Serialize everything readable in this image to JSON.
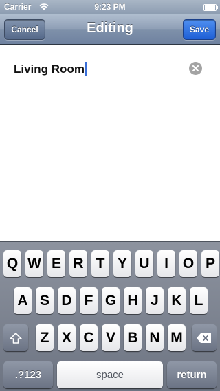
{
  "status_bar": {
    "carrier": "Carrier",
    "time": "9:23 PM",
    "wifi_icon": "wifi-icon",
    "battery_icon": "battery-icon"
  },
  "nav_bar": {
    "title": "Editing",
    "cancel_label": "Cancel",
    "save_label": "Save",
    "save_color": "#2a6ae0"
  },
  "field": {
    "value": "Living Room",
    "clear_icon": "clear-icon"
  },
  "keyboard": {
    "row1": [
      "Q",
      "W",
      "E",
      "R",
      "T",
      "Y",
      "U",
      "I",
      "O",
      "P"
    ],
    "row2": [
      "A",
      "S",
      "D",
      "F",
      "G",
      "H",
      "J",
      "K",
      "L"
    ],
    "row3": [
      "Z",
      "X",
      "C",
      "V",
      "B",
      "N",
      "M"
    ],
    "shift_icon": "shift-icon",
    "delete_icon": "delete-icon",
    "numbers_label": ".?123",
    "space_label": "space",
    "return_label": "return"
  }
}
